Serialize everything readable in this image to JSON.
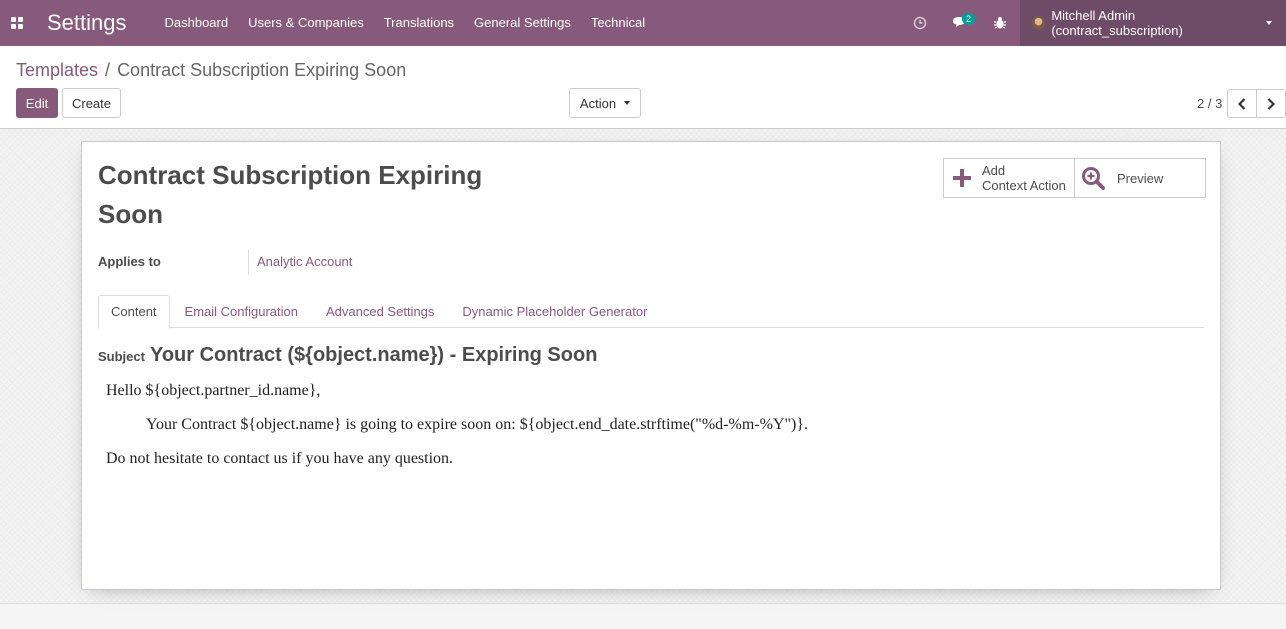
{
  "navbar": {
    "brand": "Settings",
    "menu": [
      "Dashboard",
      "Users & Companies",
      "Translations",
      "General Settings",
      "Technical"
    ],
    "messages_count": "2",
    "user_name": "Mitchell Admin (contract_subscription)"
  },
  "breadcrumb": {
    "parent": "Templates",
    "separator": "/",
    "current": "Contract Subscription Expiring Soon"
  },
  "toolbar": {
    "edit_label": "Edit",
    "create_label": "Create",
    "action_label": "Action",
    "pager_value": "2 / 3"
  },
  "record": {
    "title": "Contract Subscription Expiring Soon",
    "add_context_line1": "Add",
    "add_context_line2": "Context Action",
    "preview_label": "Preview",
    "applies_to_label": "Applies to",
    "applies_to_value": "Analytic Account"
  },
  "tabs": [
    "Content",
    "Email Configuration",
    "Advanced Settings",
    "Dynamic Placeholder Generator"
  ],
  "content": {
    "subject_label": "Subject",
    "subject_value": "Your Contract (${object.name}) - Expiring Soon",
    "line1": "Hello ${object.partner_id.name},",
    "line2": "Your Contract ${object.name} is going to expire soon on: ${object.end_date.strftime(\"%d-%m-%Y\")}.",
    "line3": "Do not hesitate to contact us if you have any question."
  },
  "colors": {
    "brand": "#875a7b",
    "brand_dark": "#6e4b66",
    "badge": "#00a09d"
  }
}
